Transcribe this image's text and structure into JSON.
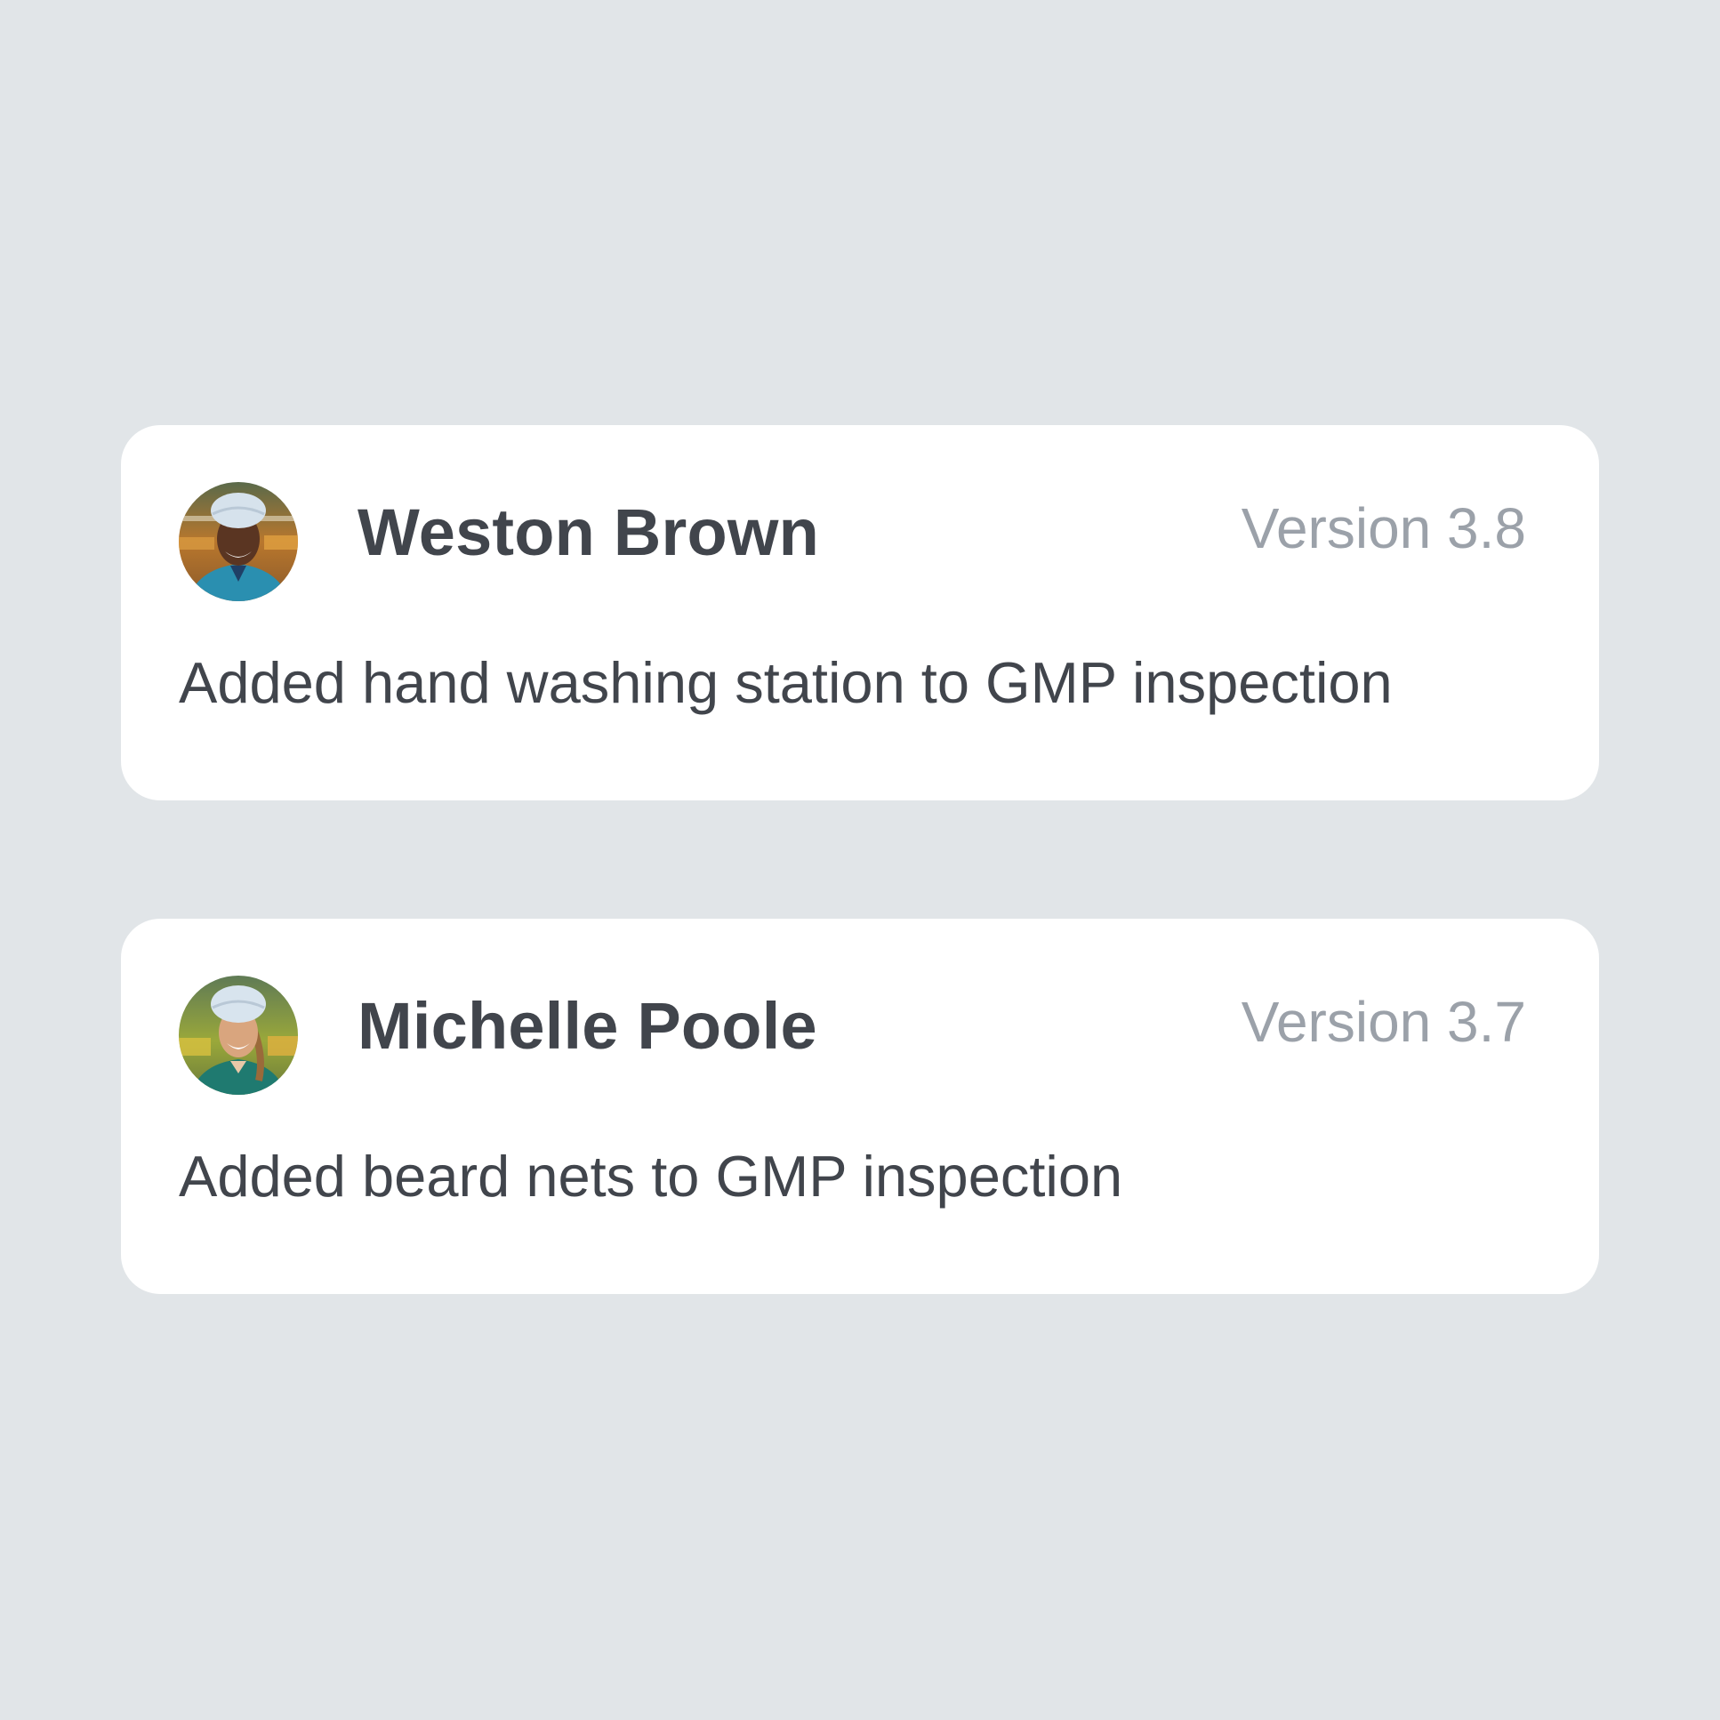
{
  "colors": {
    "background": "#e1e5e8",
    "card": "#ffffff",
    "name_text": "#41454c",
    "version_text": "#9ba1a9",
    "description_text": "#41454c"
  },
  "entries": [
    {
      "name": "Weston Brown",
      "version": "Version 3.8",
      "description": "Added hand washing station to GMP inspection",
      "avatar_icon": "user-avatar-photo"
    },
    {
      "name": "Michelle Poole",
      "version": "Version 3.7",
      "description": "Added beard nets to GMP inspection",
      "avatar_icon": "user-avatar-photo"
    }
  ]
}
